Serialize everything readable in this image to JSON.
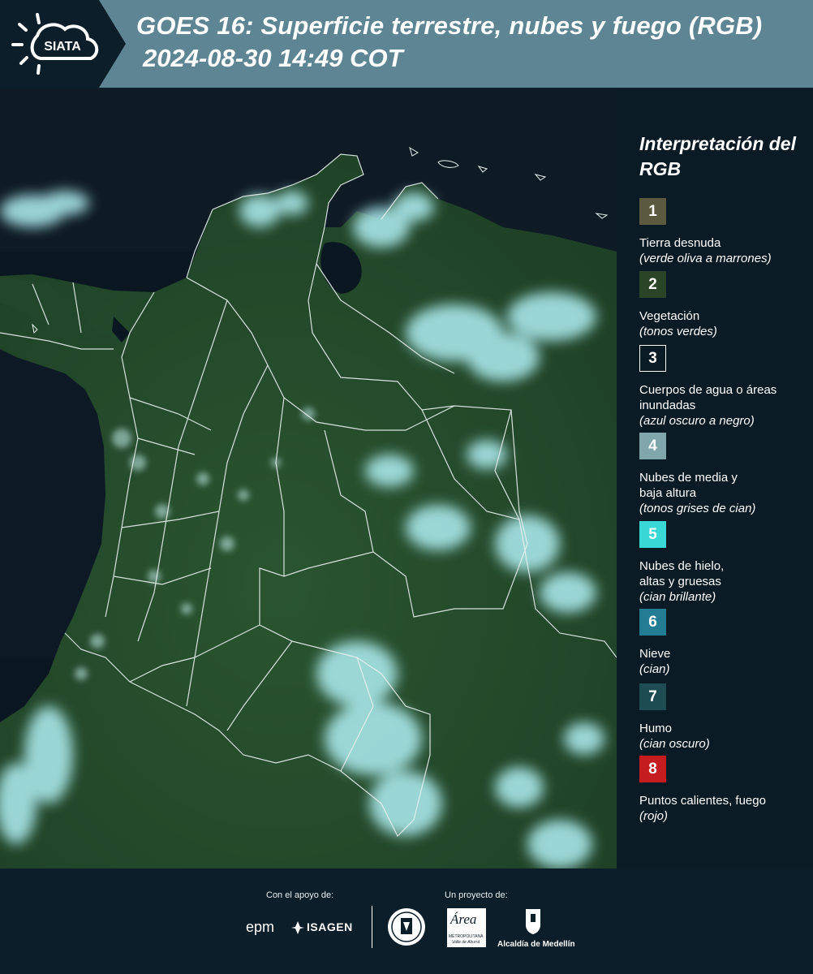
{
  "header": {
    "logo_text": "SIATA",
    "title_line1": "GOES 16: Superficie terrestre, nubes y fuego (RGB)",
    "title_line2": "2024-08-30 14:49 COT",
    "colors": {
      "header_bg": "#5d8594",
      "logo_bg": "#0c1e29"
    }
  },
  "map": {
    "description_icon": "satellite-rgb-image",
    "colors": {
      "land": "#234a2a",
      "sea": "#0b1720",
      "cloud": "#9fe3e6",
      "borders": "#e9f2f0"
    }
  },
  "legend": {
    "title": "Interpretación del RGB",
    "items": [
      {
        "number": "1",
        "label": "Tierra desnuda",
        "note": "(verde oliva a marrones)",
        "color": "#5c5a3e"
      },
      {
        "number": "2",
        "label": "Vegetación",
        "note": "(tonos verdes)",
        "color": "#2b4326"
      },
      {
        "number": "3",
        "label": "Cuerpos de agua o áreas inundadas",
        "note": "(azul oscuro a negro)",
        "color": "#0b1b25"
      },
      {
        "number": "4",
        "label": "Nubes de media y baja altura",
        "note": "(tonos grises de cian)",
        "color": "#7fa7ab"
      },
      {
        "number": "5",
        "label": "Nubes de hielo, altas y gruesas",
        "note": "(cian brillante)",
        "color": "#39d7d6"
      },
      {
        "number": "6",
        "label": "Nieve",
        "note": "(cian)",
        "color": "#227c93"
      },
      {
        "number": "7",
        "label": "Humo",
        "note": "(cian oscuro)",
        "color": "#1d4c52"
      },
      {
        "number": "8",
        "label": "Puntos calientes, fuego",
        "note": "(rojo)",
        "color": "#c41c1f"
      }
    ]
  },
  "footer": {
    "support_label": "Con el apoyo de:",
    "project_label": "Un proyecto de:",
    "sponsor1": "epm",
    "sponsor2": "ISAGEN",
    "partner1_text": "Área",
    "partner1_sub": "METROPOLITANA",
    "partner1_sub2": "Valle de Aburrá",
    "partner2": "Alcaldía de Medellín"
  }
}
